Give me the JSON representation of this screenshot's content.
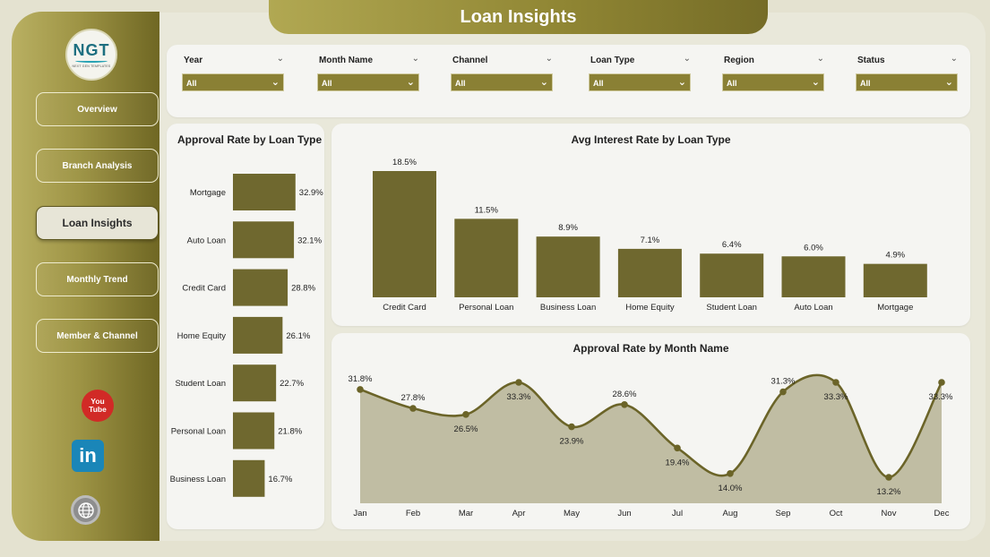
{
  "title": "Loan Insights",
  "logo": {
    "mark": "NGT",
    "subtitle": "NEXT GEN TEMPLATES"
  },
  "nav": [
    {
      "label": "Overview",
      "active": false
    },
    {
      "label": "Branch Analysis",
      "active": false
    },
    {
      "label": "Loan Insights",
      "active": true
    },
    {
      "label": "Monthly Trend",
      "active": false
    },
    {
      "label": "Member & Channel",
      "active": false
    }
  ],
  "social": {
    "youtube": "You Tube",
    "linkedin": "in"
  },
  "filters": [
    {
      "label": "Year",
      "value": "All"
    },
    {
      "label": "Month Name",
      "value": "All"
    },
    {
      "label": "Channel",
      "value": "All"
    },
    {
      "label": "Loan Type",
      "value": "All"
    },
    {
      "label": "Region",
      "value": "All"
    },
    {
      "label": "Status",
      "value": "All"
    }
  ],
  "colors": {
    "bar": "#6f682f",
    "accent": "#8f8533",
    "area_fill": "#c0bda3",
    "line": "#6b6428"
  },
  "chart_data": [
    {
      "type": "bar",
      "orientation": "horizontal",
      "title": "Approval Rate by Loan Type",
      "categories": [
        "Mortgage",
        "Auto Loan",
        "Credit Card",
        "Home Equity",
        "Student Loan",
        "Personal Loan",
        "Business Loan"
      ],
      "values": [
        32.9,
        32.1,
        28.8,
        26.1,
        22.7,
        21.8,
        16.7
      ],
      "labels": [
        "32.9%",
        "32.1%",
        "28.8%",
        "26.1%",
        "22.7%",
        "21.8%",
        "16.7%"
      ],
      "unit": "%"
    },
    {
      "type": "bar",
      "title": "Avg Interest Rate by Loan Type",
      "categories": [
        "Credit Card",
        "Personal Loan",
        "Business Loan",
        "Home Equity",
        "Student Loan",
        "Auto Loan",
        "Mortgage"
      ],
      "values": [
        18.5,
        11.5,
        8.9,
        7.1,
        6.4,
        6.0,
        4.9
      ],
      "labels": [
        "18.5%",
        "11.5%",
        "8.9%",
        "7.1%",
        "6.4%",
        "6.0%",
        "4.9%"
      ],
      "unit": "%"
    },
    {
      "type": "area",
      "title": "Approval Rate by Month Name",
      "categories": [
        "Jan",
        "Feb",
        "Mar",
        "Apr",
        "May",
        "Jun",
        "Jul",
        "Aug",
        "Sep",
        "Oct",
        "Nov",
        "Dec"
      ],
      "values": [
        31.8,
        27.8,
        26.5,
        33.3,
        23.9,
        28.6,
        19.4,
        14.0,
        31.3,
        33.3,
        13.2,
        33.3
      ],
      "labels": [
        "31.8%",
        "27.8%",
        "26.5%",
        "33.3%",
        "23.9%",
        "28.6%",
        "19.4%",
        "14.0%",
        "31.3%",
        "33.3%",
        "13.2%",
        "33.3%"
      ],
      "label_position": [
        "above",
        "above",
        "below",
        "below",
        "below",
        "above",
        "below",
        "below",
        "above",
        "below",
        "below",
        "below"
      ],
      "unit": "%"
    }
  ]
}
